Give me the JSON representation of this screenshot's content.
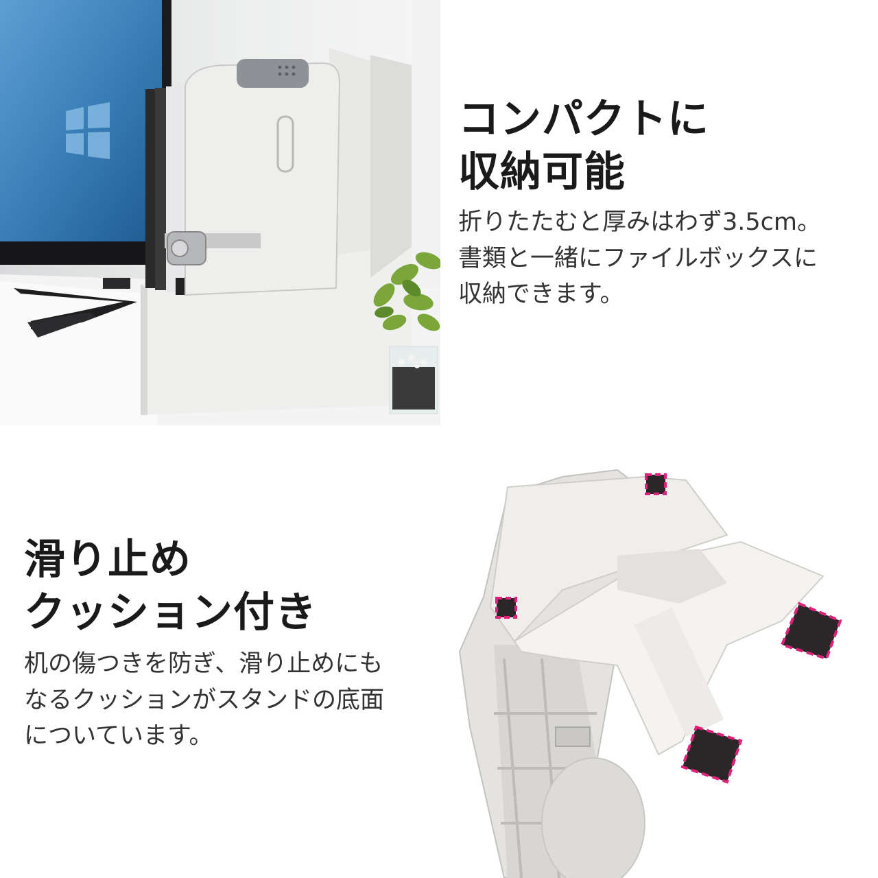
{
  "sections": [
    {
      "heading": [
        "コンパクトに",
        "収納可能"
      ],
      "body": [
        "折りたたむと厚みはわず3.5cm。",
        "書類と一緒にファイルボックスに",
        "収納できます。"
      ]
    },
    {
      "heading": [
        "滑り止め",
        "クッション付き"
      ],
      "body": [
        "机の傷つきを防ぎ、滑り止めにも",
        "なるクッションがスタンドの底面",
        "についています。"
      ]
    }
  ],
  "colors": {
    "accent": "#e0217a",
    "pad": "#2b2628",
    "stand": "#ecebe8",
    "monitor_screen": "#3a7fb8"
  }
}
